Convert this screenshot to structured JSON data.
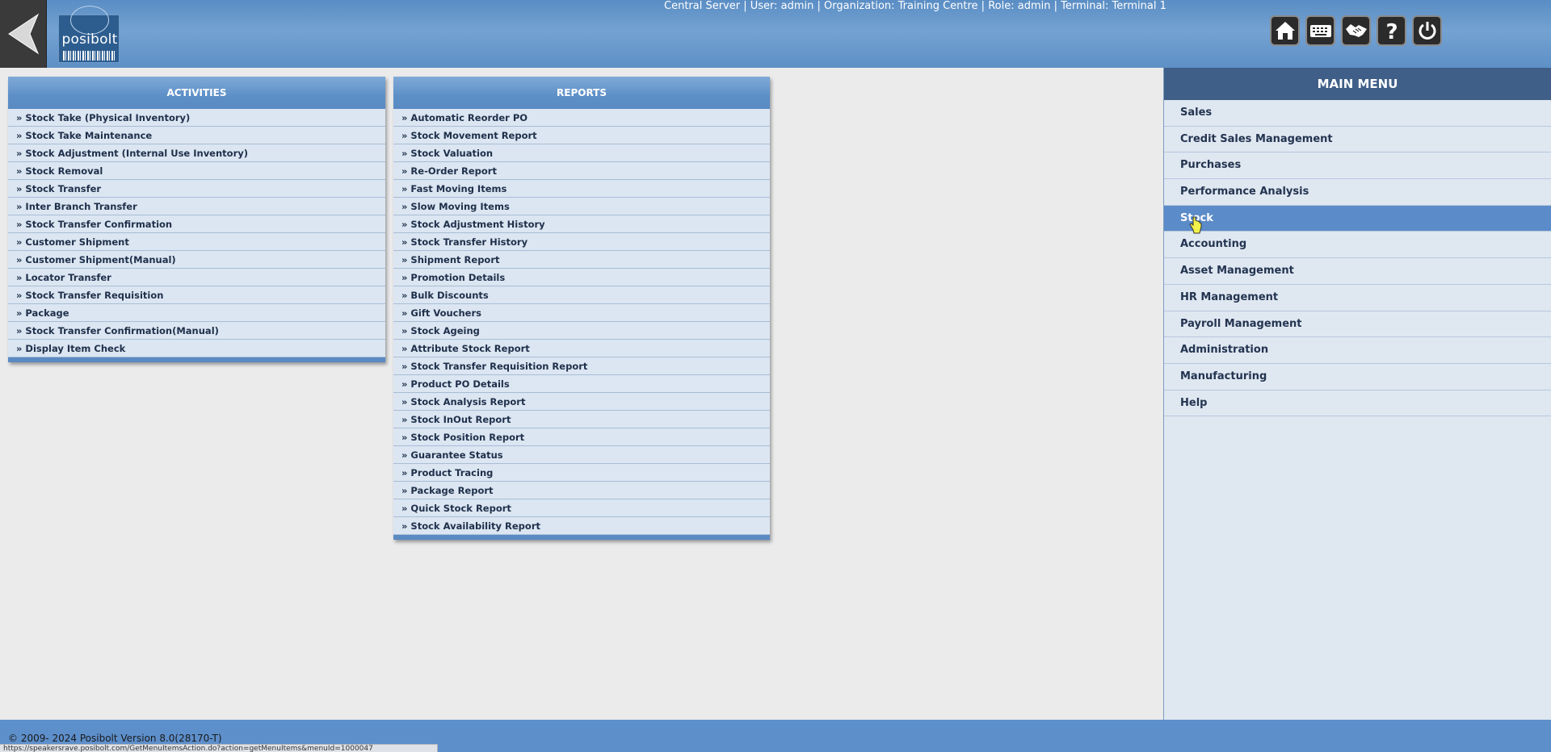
{
  "header": {
    "logo_text": "posibolt",
    "session_info": "Central Server | User: admin | Organization: Training Centre | Role: admin | Terminal: Terminal 1",
    "toolbar_icons": [
      "home-icon",
      "keyboard-icon",
      "handshake-icon",
      "help-icon",
      "power-icon"
    ]
  },
  "activities": {
    "title": "ACTIVITIES",
    "items": [
      "» Stock Take (Physical Inventory)",
      "» Stock Take Maintenance",
      "» Stock Adjustment (Internal Use Inventory)",
      "» Stock Removal",
      "» Stock Transfer",
      "» Inter Branch Transfer",
      "» Stock Transfer Confirmation",
      "» Customer Shipment",
      "» Customer Shipment(Manual)",
      "» Locator Transfer",
      "» Stock Transfer Requisition",
      "» Package",
      "» Stock Transfer Confirmation(Manual)",
      "» Display Item Check"
    ]
  },
  "reports": {
    "title": "REPORTS",
    "items": [
      "» Automatic Reorder PO",
      "» Stock Movement Report",
      "» Stock Valuation",
      "» Re-Order Report",
      "» Fast Moving Items",
      "» Slow Moving Items",
      "» Stock Adjustment History",
      "» Stock Transfer History",
      "» Shipment Report",
      "» Promotion Details",
      "» Bulk Discounts",
      "» Gift Vouchers",
      "» Stock Ageing",
      "» Attribute Stock Report",
      "» Stock Transfer Requisition Report",
      "» Product PO Details",
      "» Stock Analysis Report",
      "» Stock InOut Report",
      "» Stock Position Report",
      "» Guarantee Status",
      "» Product Tracing",
      "» Package Report",
      "» Quick Stock Report",
      "» Stock Availability Report"
    ]
  },
  "main_menu": {
    "title": "MAIN MENU",
    "items": [
      "Sales",
      "Credit Sales Management",
      "Purchases",
      "Performance Analysis",
      "Stock",
      "Accounting",
      "Asset Management",
      "HR Management",
      "Payroll Management",
      "Administration",
      "Manufacturing",
      "Help"
    ],
    "active_item": "Stock"
  },
  "footer": {
    "copyright": "© 2009- 2024 Posibolt Version 8.0(28170-T)",
    "status_url": "https://speakersrave.posibolt.com/GetMenuItemsAction.do?action=getMenuItems&menuId=1000047"
  }
}
